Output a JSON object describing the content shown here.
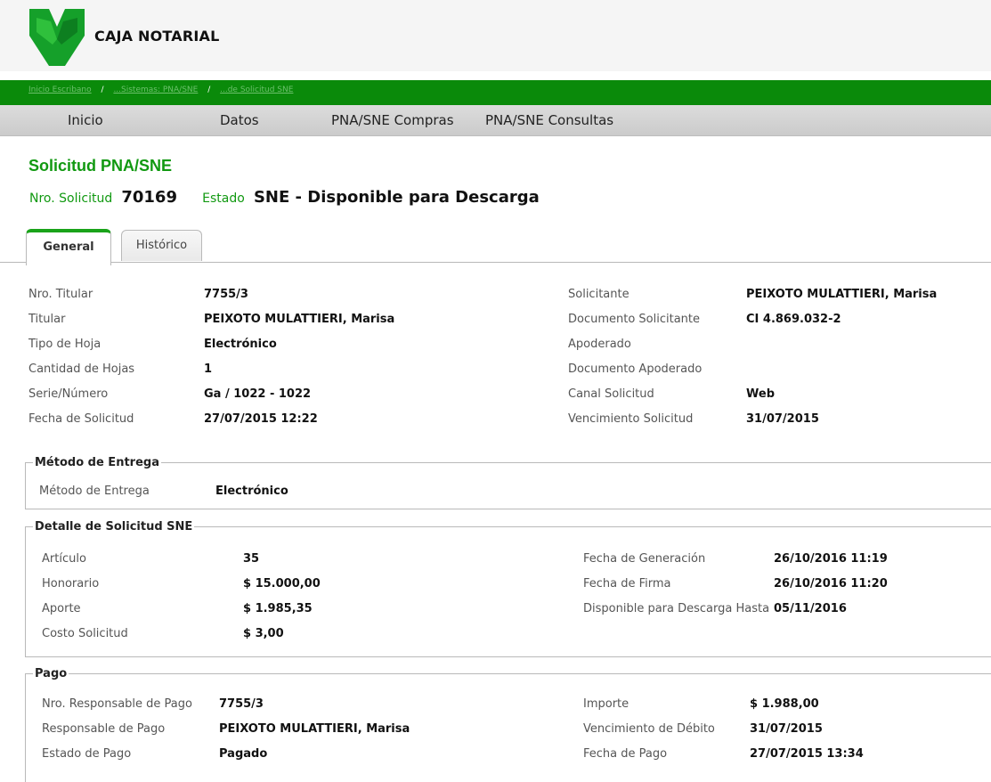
{
  "brand": {
    "name": "CAJA NOTARIAL"
  },
  "breadcrumbs": [
    {
      "label": "Inicio Escribano"
    },
    {
      "label": "...Sistemas: PNA/SNE"
    },
    {
      "label": "...de Solicitud SNE"
    }
  ],
  "breadcrumb_separator": "/",
  "nav": [
    "Inicio",
    "Datos",
    "PNA/SNE Compras",
    "PNA/SNE Consultas"
  ],
  "page": {
    "title": "Solicitud PNA/SNE",
    "nro_label": "Nro. Solicitud",
    "nro_value": "70169",
    "estado_label": "Estado",
    "estado_value": "SNE - Disponible para Descarga"
  },
  "tabs": [
    "General",
    "Histórico"
  ],
  "general": {
    "left": [
      {
        "label": "Nro. Titular",
        "value": "7755/3"
      },
      {
        "label": "Titular",
        "value": "PEIXOTO MULATTIERI, Marisa"
      },
      {
        "label": "Tipo de Hoja",
        "value": "Electrónico"
      },
      {
        "label": "Cantidad de Hojas",
        "value": "1"
      },
      {
        "label": "Serie/Número",
        "value": "Ga / 1022 - 1022"
      },
      {
        "label": "Fecha de Solicitud",
        "value": "27/07/2015 12:22"
      }
    ],
    "right": [
      {
        "label": "Solicitante",
        "value": "PEIXOTO MULATTIERI, Marisa"
      },
      {
        "label": "Documento Solicitante",
        "value": "CI 4.869.032-2"
      },
      {
        "label": "Apoderado",
        "value": ""
      },
      {
        "label": "Documento Apoderado",
        "value": ""
      },
      {
        "label": "Canal Solicitud",
        "value": "Web"
      },
      {
        "label": "Vencimiento Solicitud",
        "value": "31/07/2015"
      }
    ]
  },
  "entrega": {
    "legend": "Método de Entrega",
    "rows": [
      {
        "label": "Método de Entrega",
        "value": "Electrónico"
      }
    ]
  },
  "detalle": {
    "legend": "Detalle de Solicitud SNE",
    "left": [
      {
        "label": "Artículo",
        "value": "35"
      },
      {
        "label": "Honorario",
        "value": "$ 15.000,00"
      },
      {
        "label": "Aporte",
        "value": "$ 1.985,35"
      },
      {
        "label": "Costo Solicitud",
        "value": "$ 3,00"
      }
    ],
    "right": [
      {
        "label": "Fecha de Generación",
        "value": "26/10/2016 11:19"
      },
      {
        "label": "Fecha de Firma",
        "value": "26/10/2016 11:20"
      },
      {
        "label": "Disponible para Descarga Hasta",
        "value": "05/11/2016"
      }
    ]
  },
  "pago": {
    "legend": "Pago",
    "left": [
      {
        "label": "Nro. Responsable de Pago",
        "value": "7755/3"
      },
      {
        "label": "Responsable de Pago",
        "value": "PEIXOTO MULATTIERI, Marisa"
      },
      {
        "label": "Estado de Pago",
        "value": "Pagado"
      }
    ],
    "right": [
      {
        "label": "Importe",
        "value": "$ 1.988,00"
      },
      {
        "label": "Vencimiento de Débito",
        "value": "31/07/2015"
      },
      {
        "label": "Fecha de Pago",
        "value": "27/07/2015 13:34"
      }
    ]
  },
  "colors": {
    "brand_green": "#0a8a0a",
    "title_green": "#119911",
    "nav_bg": "#d3d3d3"
  }
}
